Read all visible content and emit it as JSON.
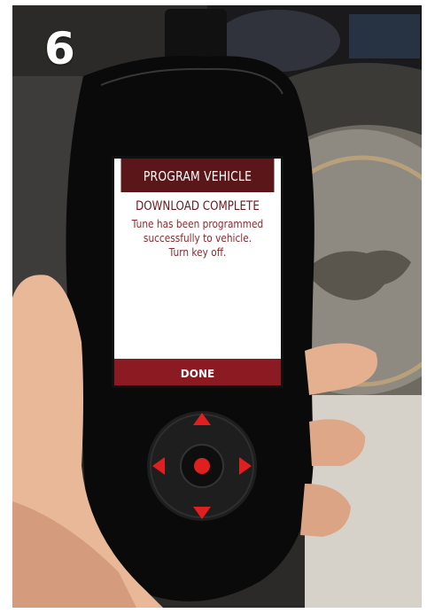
{
  "step": {
    "number": "6"
  },
  "device": {
    "screen": {
      "title": "PROGRAM VEHICLE",
      "heading": "DOWNLOAD COMPLETE",
      "message_lines": [
        "Tune has been programmed",
        "successfully to vehicle.",
        "Turn key off."
      ],
      "button_label": "DONE"
    }
  },
  "colors": {
    "title_bar": "#5a1618",
    "button": "#8b1a22",
    "heading_text": "#6a1a20",
    "arrow_red": "#e02020"
  }
}
